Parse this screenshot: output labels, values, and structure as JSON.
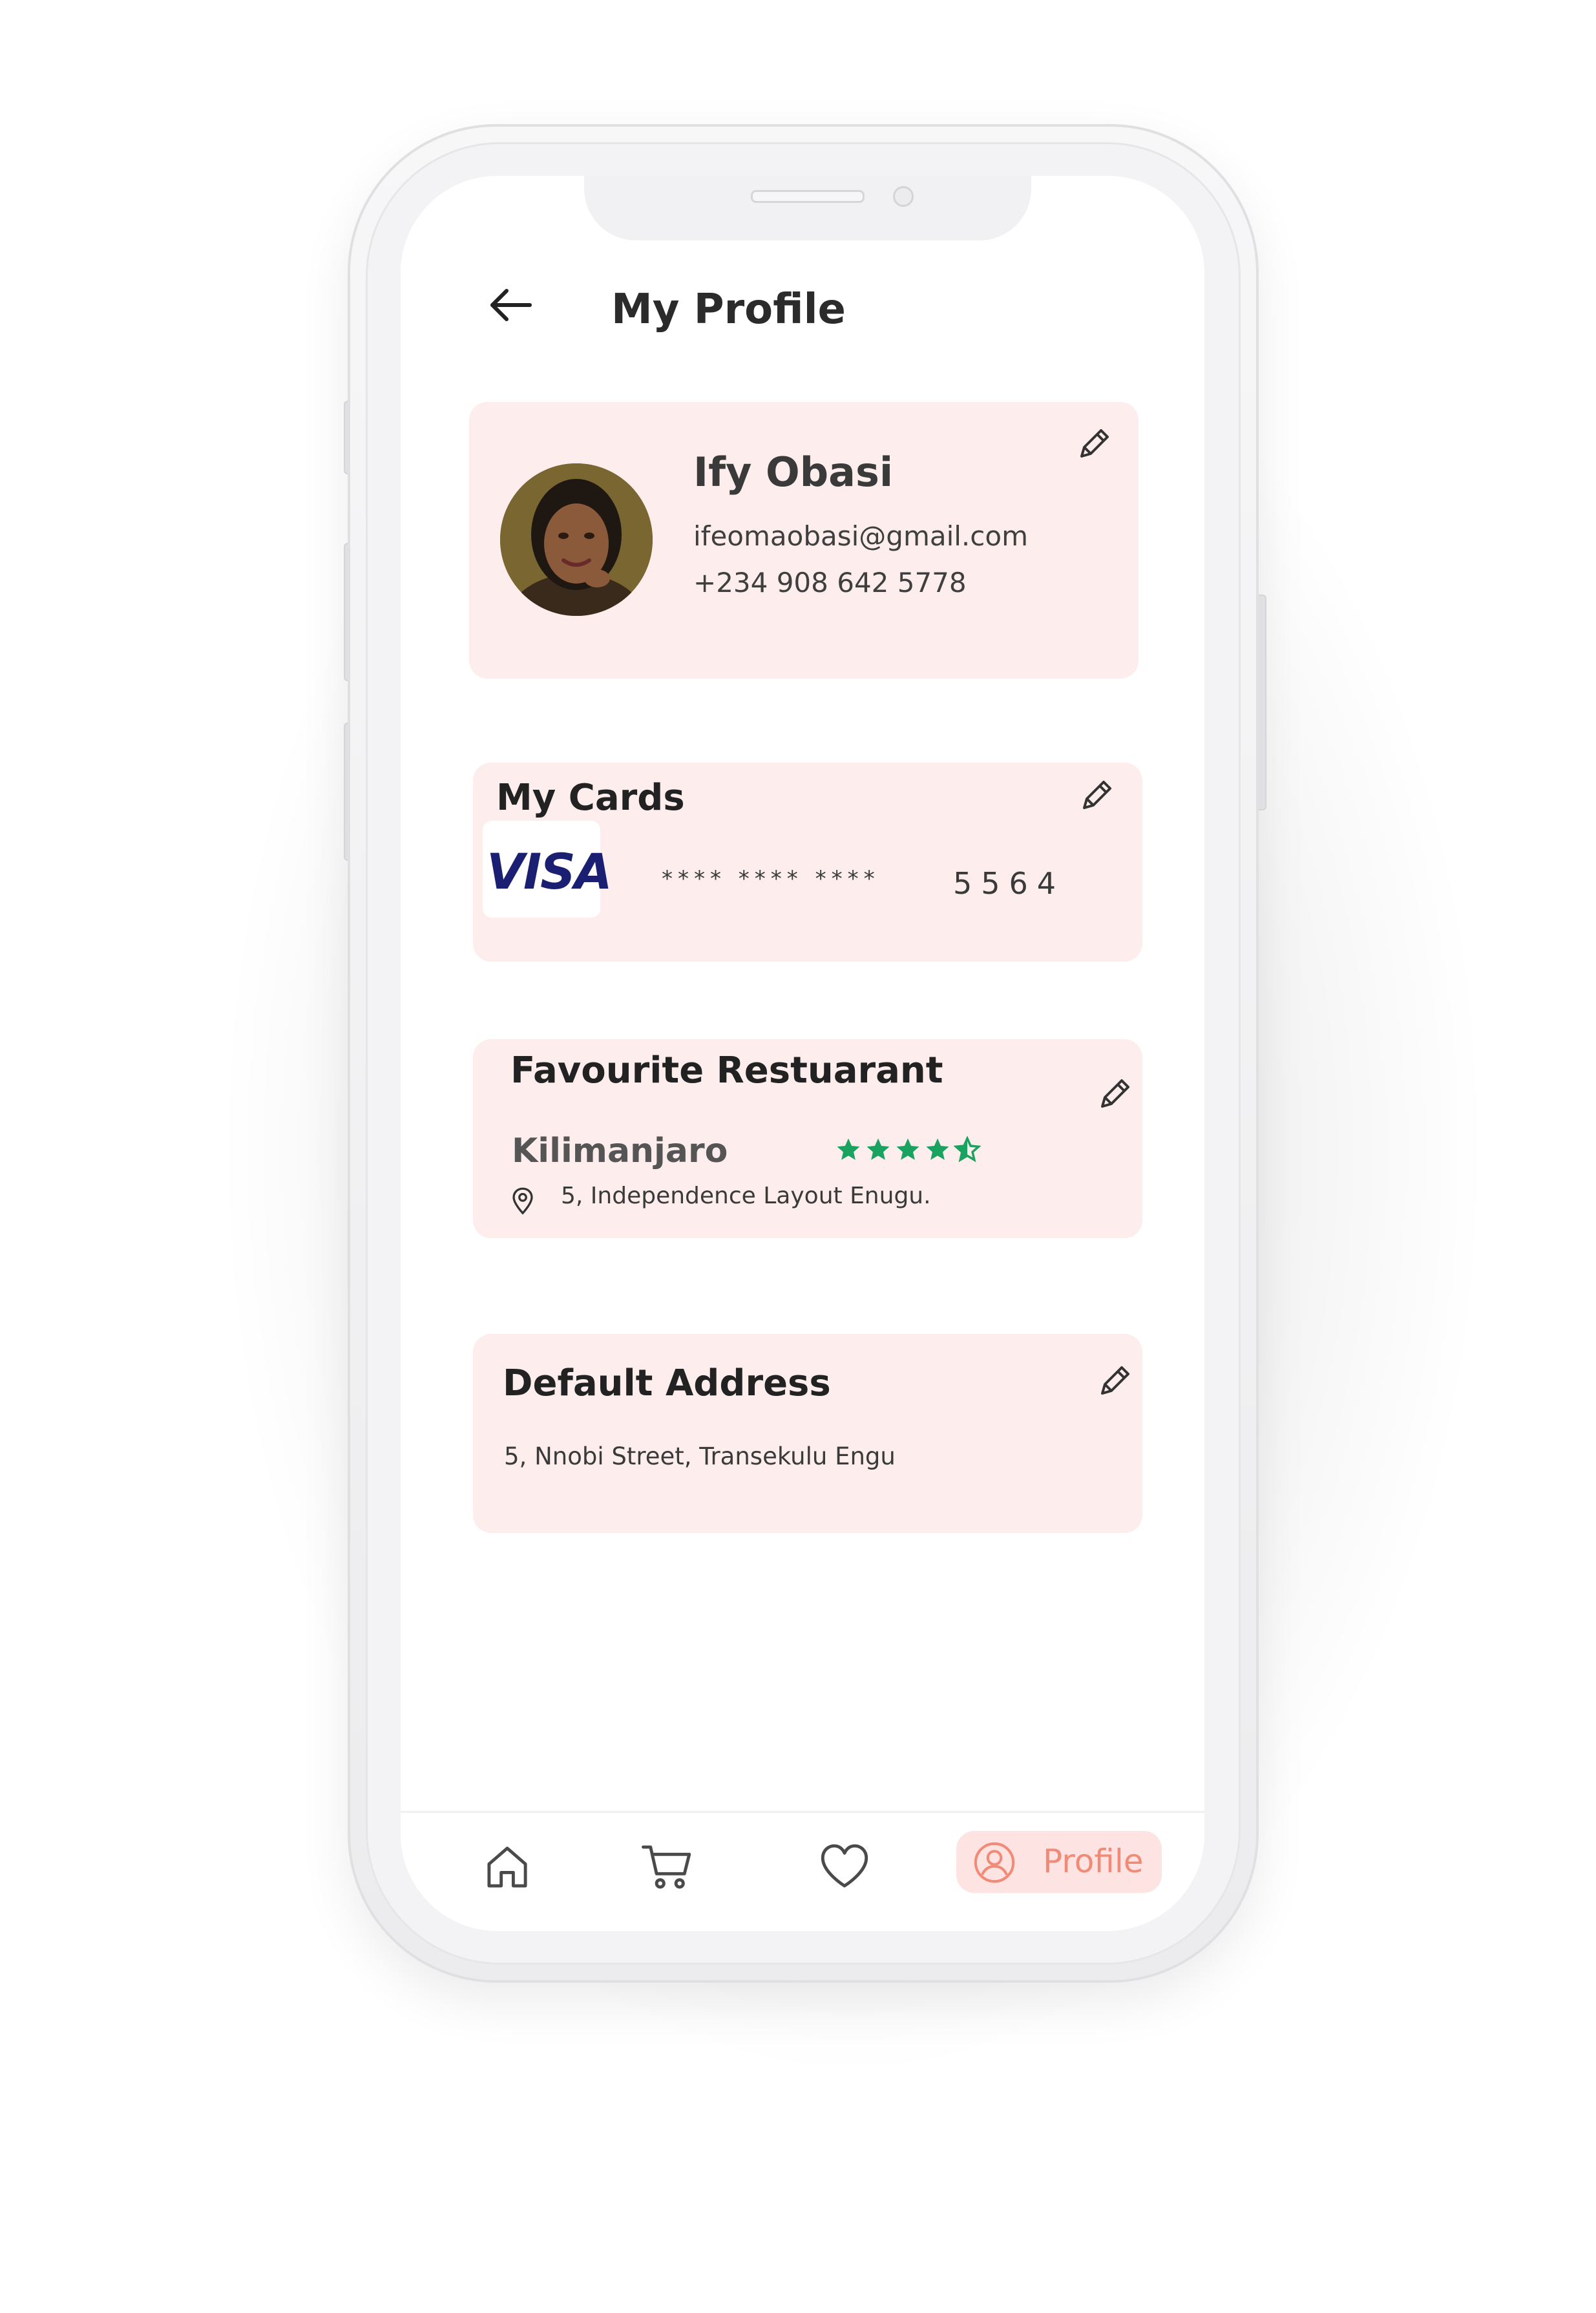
{
  "header": {
    "title": "My Profile"
  },
  "profile": {
    "name": "Ify Obasi",
    "email": "ifeomaobasi@gmail.com",
    "phone": "+234 908 642 5778"
  },
  "cards": {
    "title": "My Cards",
    "brand": "VISA",
    "masked": "**** **** ****",
    "last4": "5564"
  },
  "favourite_restaurant": {
    "title": "Favourite Restuarant",
    "name": "Kilimanjaro",
    "rating": 4.5,
    "rating_max": 5,
    "address": "5, Independence Layout Enugu."
  },
  "default_address": {
    "title": "Default Address",
    "address": "5, Nnobi Street, Transekulu Engu"
  },
  "bottom_nav": {
    "items": [
      {
        "icon": "home-icon"
      },
      {
        "icon": "cart-icon"
      },
      {
        "icon": "heart-icon"
      },
      {
        "icon": "profile-icon",
        "label": "Profile",
        "active": true
      }
    ]
  },
  "colors": {
    "card_bg": "#fdeeed",
    "accent": "#f18a76",
    "active_tab_bg": "#fde3e1",
    "star": "#1aa260",
    "visa_blue": "#1a1f71"
  }
}
